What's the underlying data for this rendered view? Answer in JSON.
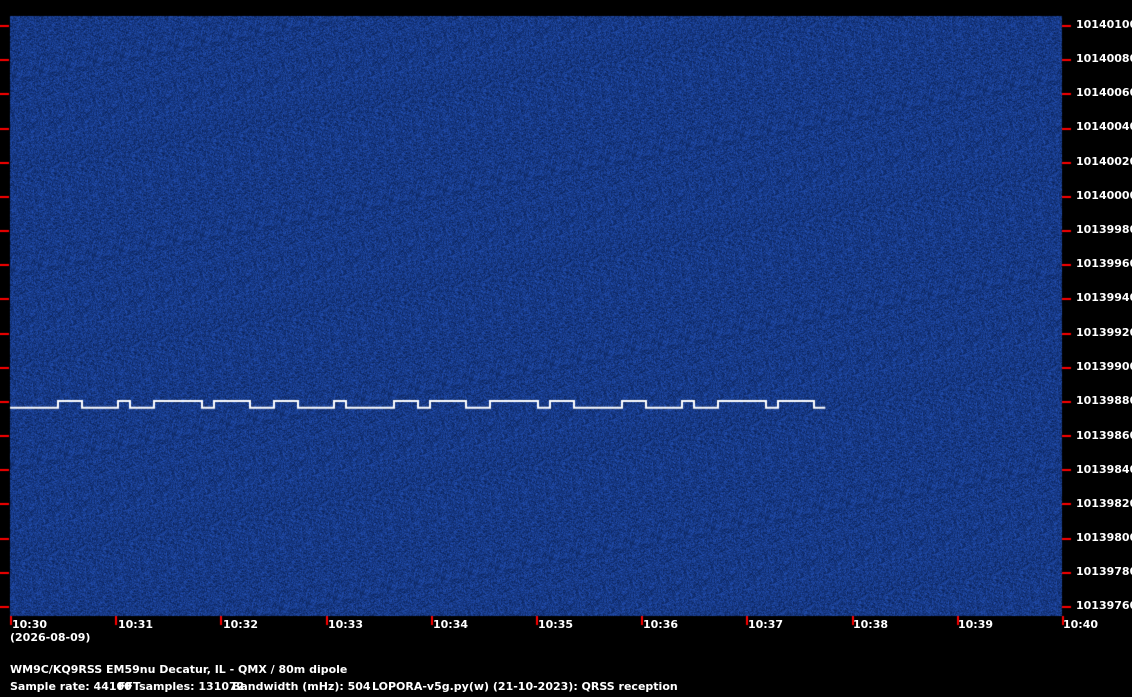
{
  "colors": {
    "background": "#000000",
    "noise_base": "#0b2a63",
    "tick": "#ff0000",
    "signal": "#ffffff"
  },
  "frequency_axis": {
    "labels": [
      "10140100",
      "10140080",
      "10140060",
      "10140040",
      "10140020",
      "10140000",
      "10139980",
      "10139960",
      "10139940",
      "10139920",
      "10139900",
      "10139880",
      "10139860",
      "10139840",
      "10139820",
      "10139800",
      "10139780",
      "10139760"
    ]
  },
  "time_axis": {
    "labels": [
      "10:30",
      "10:31",
      "10:32",
      "10:33",
      "10:34",
      "10:35",
      "10:36",
      "10:37",
      "10:38",
      "10:39",
      "10:40"
    ],
    "date": "(2026-08-09)"
  },
  "footer": {
    "station": "WM9C/KQ9RSS EM59nu Decatur, IL - QMX / 80m dipole",
    "sample_rate": "Sample rate: 44100",
    "fft_samples": "FFTsamples: 131072",
    "bandwidth": "Bandwidth (mHz): 504",
    "software": "LOPORA-v5g.py(w) (21-10-2023): QRSS reception"
  },
  "signal": {
    "description_free": true,
    "start_time": "10:30",
    "end_time_minutes": 7.75,
    "base_frequency_hz": 10139876,
    "shift_frequency_hz": 10139880
  }
}
